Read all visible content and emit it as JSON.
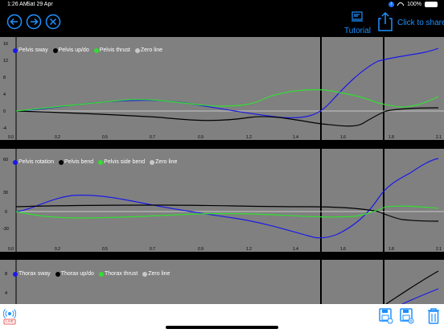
{
  "status": {
    "time": "1:26 AM",
    "date": "Sat 29 Apr",
    "battery": "100%"
  },
  "toolbar": {
    "back_icon": "circle-left-arrow-icon",
    "forward_icon": "circle-right-arrow-icon",
    "close_icon": "circle-x-icon",
    "tutorial_label": "Tutorial",
    "share_label": "Click to share"
  },
  "colors": {
    "accent": "#1e90ff",
    "panel_bg": "#808080",
    "blue": "#1a1ae6",
    "green": "#33dd33",
    "black": "#000000",
    "zero": "#c8c8c8"
  },
  "panels": [
    {
      "legend": [
        "Pelvis sway",
        "Pelvis up/do",
        "Pelvis thrust",
        "Zero line"
      ],
      "y_ticks": [
        "16",
        "12",
        "8",
        "4",
        "0",
        "-4"
      ],
      "x_ticks": [
        "0.0",
        "0.2",
        "0.5",
        "0.7",
        "0.9",
        "1.2",
        "1.4",
        "1.6",
        "1.8",
        "2.1"
      ]
    },
    {
      "legend": [
        "Pelvis rotation",
        "Pelvis bend",
        "Pelvis side bend",
        "Zero line"
      ],
      "y_ticks": [
        "60",
        "30",
        "0",
        "-30"
      ],
      "x_ticks": [
        "0.0",
        "0.2",
        "0.5",
        "0.7",
        "0.9",
        "1.2",
        "1.4",
        "1.6",
        "1.8",
        "2.1"
      ]
    },
    {
      "legend": [
        "Thorax sway",
        "Thorax up/do",
        "Thorax thrust",
        "Zero line"
      ],
      "y_ticks": [
        "8",
        "4"
      ],
      "x_ticks": []
    }
  ],
  "bottom": {
    "live_label": "LIVE"
  }
}
